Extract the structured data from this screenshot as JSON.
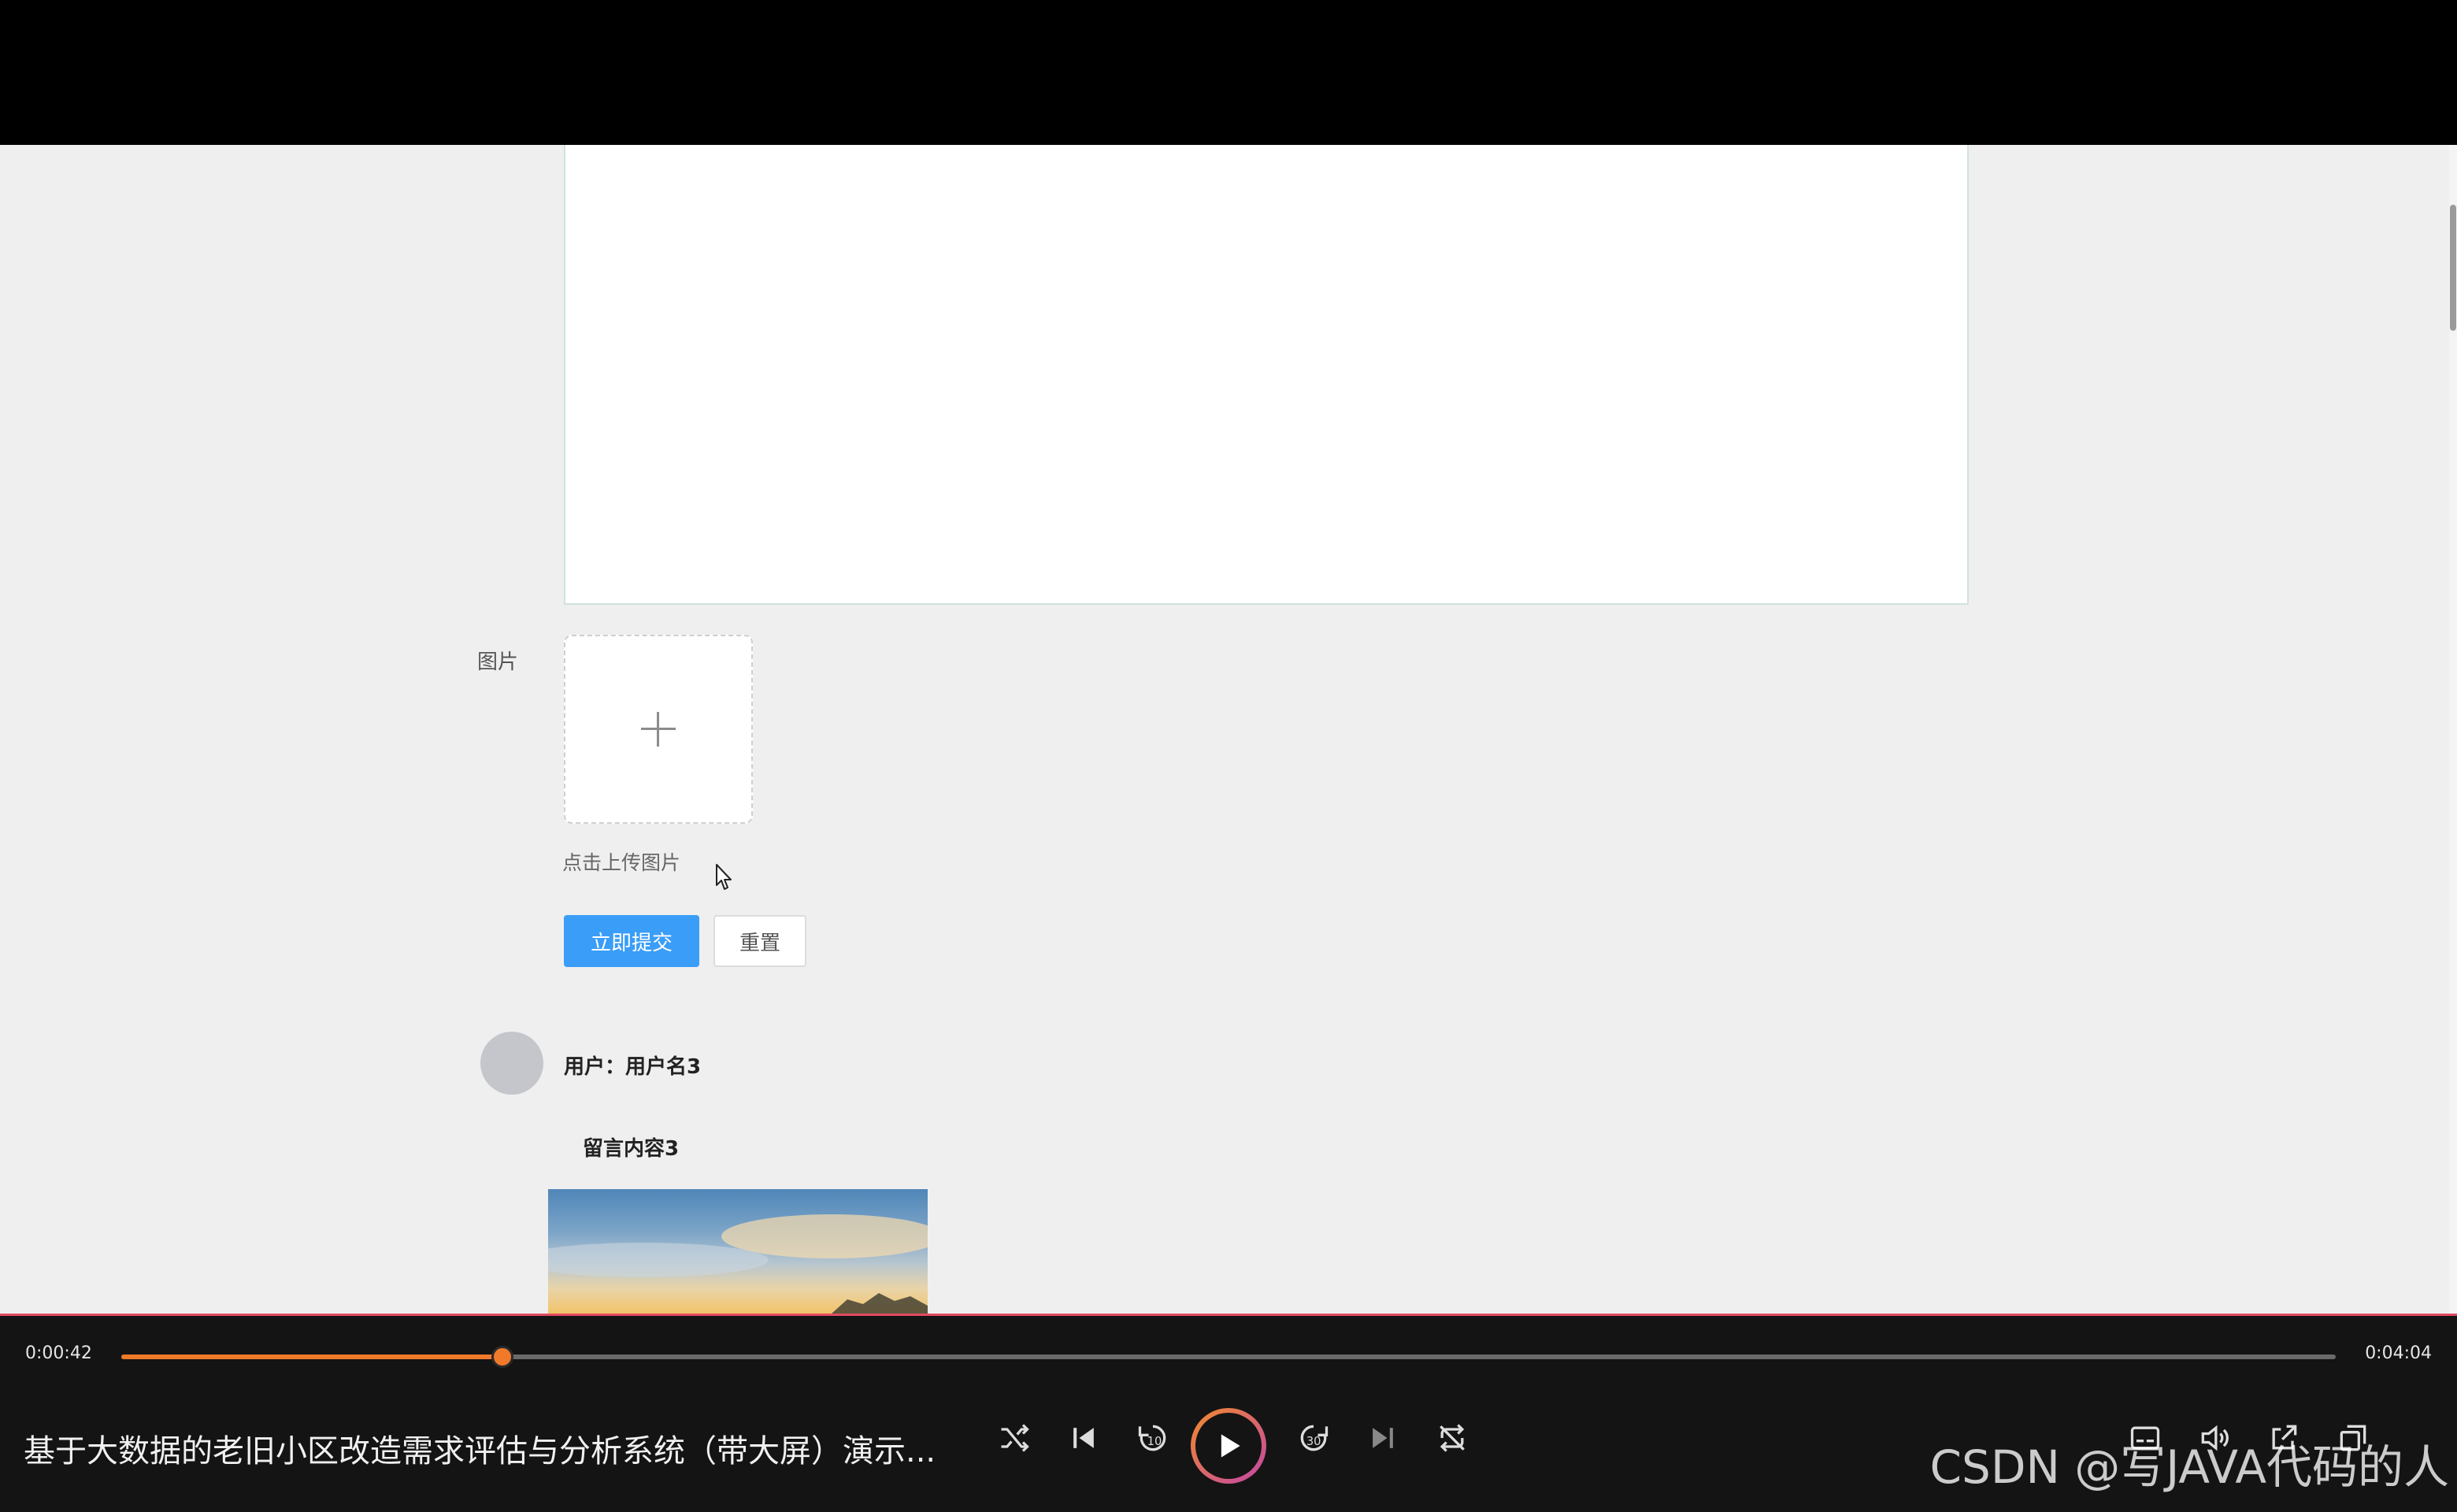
{
  "form": {
    "image_label": "图片",
    "upload_hint": "点击上传图片",
    "submit_label": "立即提交",
    "reset_label": "重置"
  },
  "comment": {
    "user_label": "用户：用户名3",
    "message": "留言内容3"
  },
  "player": {
    "current_time": "0:00:42",
    "total_time": "0:04:04",
    "progress_fraction": 0.1721,
    "title": "基于大数据的老旧小区改造需求评估与分析系统（带大屏）演示...",
    "accent_color": "#f07a2a",
    "icons": [
      "shuffle-icon",
      "previous-icon",
      "rewind-10-icon",
      "play-icon",
      "forward-30-icon",
      "next-icon",
      "repeat-off-icon",
      "subtitles-icon",
      "volume-icon",
      "share-icon",
      "fullscreen-icon"
    ]
  },
  "watermark": "CSDN @写JAVA代码的人"
}
